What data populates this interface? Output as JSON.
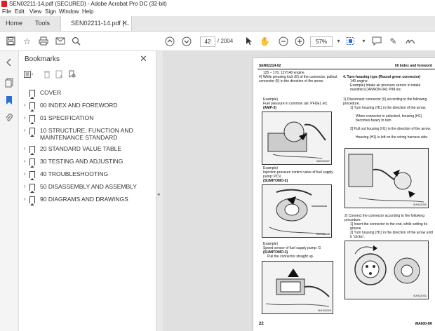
{
  "window": {
    "title": "SEN02211-14.pdf (SECURED) - Adobe Acrobat Pro DC (32-bit)"
  },
  "menu": [
    "File",
    "Edit",
    "View",
    "Sign",
    "Window",
    "Help"
  ],
  "tabs": {
    "home": "Home",
    "tools": "Tools",
    "document": "SEN02211-14.pdf (..."
  },
  "toolbar": {
    "page_current": "42",
    "page_total": "/ 2004",
    "zoom": "57%"
  },
  "bookmarks": {
    "header": "Bookmarks",
    "items": [
      {
        "label": "COVER",
        "expandable": false
      },
      {
        "label": "00 INDEX AND FOREWORD",
        "expandable": true
      },
      {
        "label": "01 SPECIFICATION",
        "expandable": true
      },
      {
        "label": "10 STRUCTURE, FUNCTION AND MAINTENANCE STANDARD",
        "expandable": true
      },
      {
        "label": "20 STANDARD VALUE TABLE",
        "expandable": true
      },
      {
        "label": "30 TESTING AND ADJUSTING",
        "expandable": true
      },
      {
        "label": "40 TROUBLESHOOTING",
        "expandable": true
      },
      {
        "label": "50 DISASSEMBLY AND ASSEMBLY",
        "expandable": true
      },
      {
        "label": "90 DIAGRAMS AND DRAWINGS",
        "expandable": true
      }
    ]
  },
  "page": {
    "header_left": "SEN02214-02",
    "header_right": "00 Index and foreword",
    "col1": {
      "p1": "125 – 170, 12V140 engine",
      "p2": "4) While pressing lock (E) of the connector, pullout connector (5) in the direction of the arrow.",
      "ex1": "Example)",
      "ex1_text": "Fuel pressure in common rail: PFUEL etc.",
      "ex1_code": "(AMP-3)",
      "fig1": "BJH12027",
      "ex2": "Example)",
      "ex2_text": "Injection pressure control valve of fuel supply pump: PCV",
      "ex2_code": "(SUMITOMO-2)",
      "fig2": "BJH12028",
      "ex3": "Example)",
      "ex3_text": "Speed sensor of fuel supply pump: G",
      "ex3_code": "(SUMITOMO-3)",
      "ex3_note": "Pull the connector straight up.",
      "fig3": "BJH12029"
    },
    "col2": {
      "sec_title": "4. Turn-housing type (Round green connector)",
      "p1": "140 engine",
      "p2": "Example) Intake air pressure sensor in intake manifold (CANNON-04): PIM etc.",
      "step1": "1) Disconnect connector (6) according to the following procedure.",
      "s1a": "1] Turn housing (H1) in the direction of the arrow.",
      "s1a_note": "When connector is unlocked, housing (H1) becomes heavy to turn.",
      "s1b": "2] Pull out housing (H1) in the direction of the arrow.",
      "s1b_note": "Housing (H1) is left on the wiring harness side.",
      "fig4": "BJH12030",
      "step2": "2) Connect the connector according to the following procedure.",
      "s2a": "1] Insert the connector to the end, while setting its groove.",
      "s2b": "2] Turn housing (H1) in the direction of the arrow until it \"clicks\".",
      "fig5": "BJH12031"
    },
    "footer_left": "22",
    "footer_right": "WA600-6R"
  }
}
